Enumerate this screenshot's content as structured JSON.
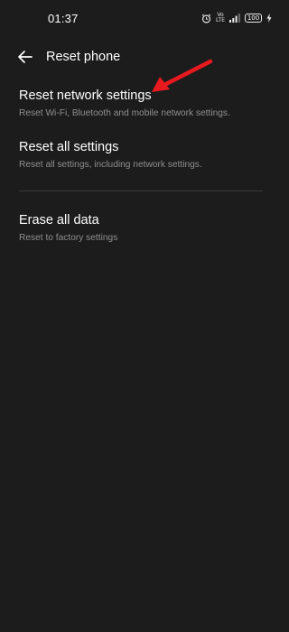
{
  "status_bar": {
    "time": "01:37",
    "volte_top": "Vo",
    "volte_bottom": "LTE",
    "battery": "100"
  },
  "header": {
    "title": "Reset phone",
    "back_icon": "arrow-left-icon"
  },
  "options": [
    {
      "title": "Reset network settings",
      "subtitle": "Reset Wi-Fi, Bluetooth and mobile network settings."
    },
    {
      "title": "Reset all settings",
      "subtitle": "Reset all settings, including network settings."
    },
    {
      "title": "Erase all data",
      "subtitle": "Reset to factory settings"
    }
  ],
  "colors": {
    "background": "#1c1c1c",
    "primary_text": "#ffffff",
    "secondary_text": "#8f8f8f",
    "divider": "#3a3a3a",
    "annotation_arrow": "#e8191f"
  }
}
